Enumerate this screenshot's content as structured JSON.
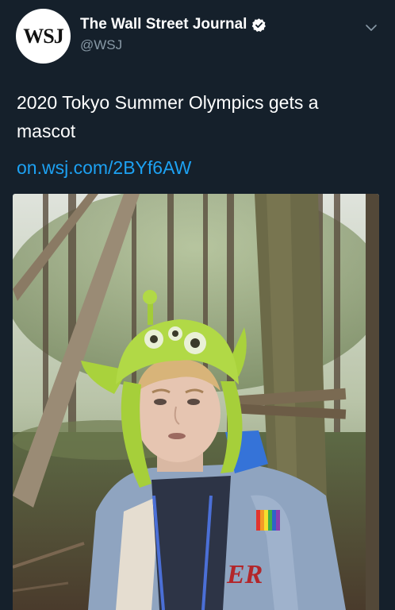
{
  "account": {
    "avatar_text": "WSJ",
    "display_name": "The Wall Street Journal",
    "handle": "@WSJ",
    "verified": true
  },
  "tweet": {
    "text": "2020 Tokyo Summer Olympics gets a mascot",
    "link": "on.wsj.com/2BYf6AW"
  },
  "media": {
    "description_icon": "photo-image",
    "jacket_text": "ER"
  },
  "colors": {
    "background": "#15202b",
    "link": "#1da1f2",
    "secondary_text": "#8899a6",
    "verified_badge": "#ffffff"
  }
}
